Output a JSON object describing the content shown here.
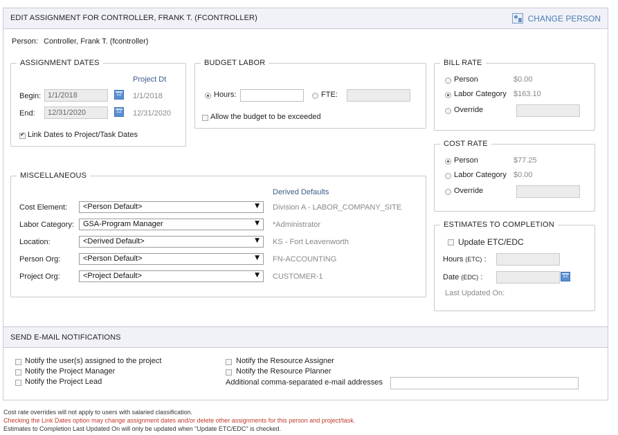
{
  "header": {
    "title": "EDIT ASSIGNMENT FOR CONTROLLER, FRANK T. (FCONTROLLER)",
    "change_person_label": "CHANGE PERSON",
    "change_person_icon": "change-person-icon"
  },
  "person": {
    "label": "Person:",
    "value": "Controller, Frank T. (fcontroller)"
  },
  "assignment_dates": {
    "legend": "ASSIGNMENT DATES",
    "project_dt_label": "Project Dt",
    "begin_label": "Begin:",
    "begin_value": "1/1/2018",
    "begin_project_dt": "1/1/2018",
    "end_label": "End:",
    "end_value": "12/31/2020",
    "end_project_dt": "12/31/2020",
    "link_dates_label": "Link Dates to Project/Task Dates",
    "link_dates_checked": true
  },
  "budget_labor": {
    "legend": "BUDGET LABOR",
    "hours_label": "Hours:",
    "hours_value": "",
    "fte_label": "FTE:",
    "fte_value": "",
    "allow_exceed_label": "Allow the budget to be exceeded",
    "selected": "hours"
  },
  "bill_rate": {
    "legend": "BILL RATE",
    "person_label": "Person",
    "person_value": "$0.00",
    "labor_category_label": "Labor Category",
    "labor_category_value": "$163.10",
    "override_label": "Override",
    "override_value": "",
    "selected": "labor_category"
  },
  "cost_rate": {
    "legend": "COST RATE",
    "person_label": "Person",
    "person_value": "$77.25",
    "labor_category_label": "Labor Category",
    "labor_category_value": "$0.00",
    "override_label": "Override",
    "override_value": "",
    "selected": "person"
  },
  "miscellaneous": {
    "legend": "MISCELLANEOUS",
    "derived_defaults_label": "Derived Defaults",
    "rows": [
      {
        "label": "Cost Element:",
        "selected": "<Person Default>",
        "derived": "Division A - LABOR_COMPANY_SITE"
      },
      {
        "label": "Labor Category:",
        "selected": "GSA-Program Manager",
        "derived": "*Administrator"
      },
      {
        "label": "Location:",
        "selected": "<Derived Default>",
        "derived": "KS - Fort Leavenworth"
      },
      {
        "label": "Person Org:",
        "selected": "<Person Default>",
        "derived": "FN-ACCOUNTING"
      },
      {
        "label": "Project Org:",
        "selected": "<Project Default>",
        "derived": "CUSTOMER-1"
      }
    ]
  },
  "etc": {
    "legend": "ESTIMATES TO COMPLETION",
    "update_label": "Update ETC/EDC",
    "hours_label": "Hours",
    "hours_abbr": "(ETC)",
    "hours_colon": ":",
    "hours_value": "",
    "date_label": "Date",
    "date_abbr": "(EDC)",
    "date_colon": ":",
    "date_value": "",
    "last_updated_label": "Last Updated On:"
  },
  "notifications": {
    "title": "SEND E-MAIL NOTIFICATIONS",
    "left": [
      "Notify the user(s) assigned to the project",
      "Notify the Project Manager",
      "Notify the Project Lead"
    ],
    "right": [
      "Notify the Resource Assigner",
      "Notify the Resource Planner"
    ],
    "additional_label": "Additional comma-separated e-mail addresses",
    "additional_value": ""
  },
  "footnotes": {
    "note1": "Cost rate overrides will not apply to users with salaried classification.",
    "note2": "Checking the Link Dates option may change assignment dates and/or delete other assignments for this person and project/task.",
    "note3": "Estimates to Completion Last Updated On will only be updated when \"Update ETC/EDC\" is checked.",
    "warning_color": "#c0392b"
  },
  "colors": {
    "header_bg": "#f1f1f8",
    "link_blue": "#4a7fb5",
    "calendar_blue": "#5b8fd0"
  }
}
